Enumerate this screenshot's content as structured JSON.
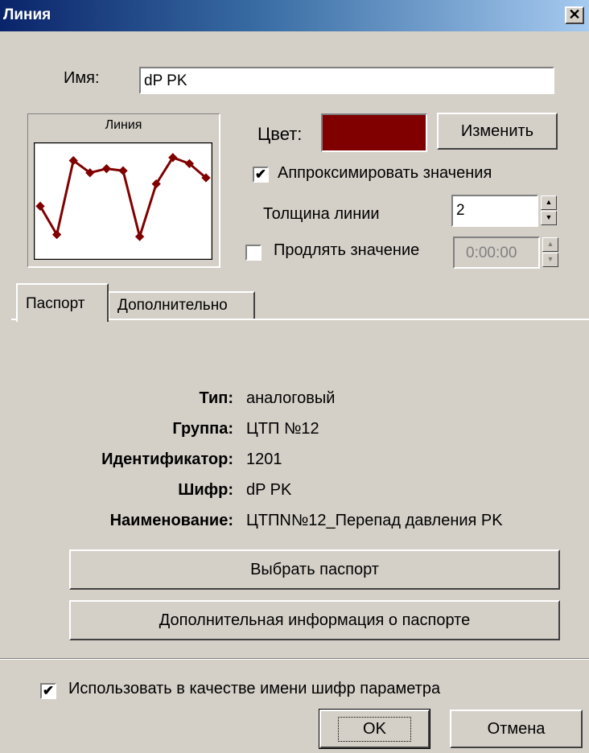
{
  "window": {
    "title": "Линия",
    "close_glyph": "✕"
  },
  "name_field": {
    "label": "Имя:",
    "value": "dP PK"
  },
  "preview": {
    "label": "Линия",
    "line_color": "#800000",
    "points": [
      0.45,
      0.17,
      0.9,
      0.78,
      0.82,
      0.8,
      0.15,
      0.67,
      0.93,
      0.87,
      0.73
    ]
  },
  "color": {
    "label": "Цвет:",
    "value": "#800000",
    "change_button": "Изменить"
  },
  "approximate": {
    "label": "Аппроксимировать значения",
    "checked": true
  },
  "thickness": {
    "label": "Толщина линии",
    "value": "2"
  },
  "extend": {
    "label": "Продлять значение",
    "checked": false,
    "value": "0:00:00"
  },
  "tabs": [
    {
      "label": "Паспорт",
      "active": true
    },
    {
      "label": "Дополнительно",
      "active": false
    }
  ],
  "passport": {
    "rows": [
      {
        "key": "Тип:",
        "value": "аналоговый"
      },
      {
        "key": "Группа:",
        "value": "ЦТП №12"
      },
      {
        "key": "Идентификатор:",
        "value": "1201"
      },
      {
        "key": "Шифр:",
        "value": "dP PK"
      },
      {
        "key": "Наименование:",
        "value": "ЦТПN№12_Перепад давления PK"
      }
    ],
    "select_button": "Выбрать паспорт",
    "info_button": "Дополнительная информация о паспорте"
  },
  "use_code_name": {
    "label": "Использовать в качестве имени шифр параметра",
    "checked": true
  },
  "footer": {
    "ok": "OK",
    "cancel": "Отмена"
  },
  "icons": {
    "check": "✔",
    "spin_up": "▲",
    "spin_down": "▼"
  }
}
